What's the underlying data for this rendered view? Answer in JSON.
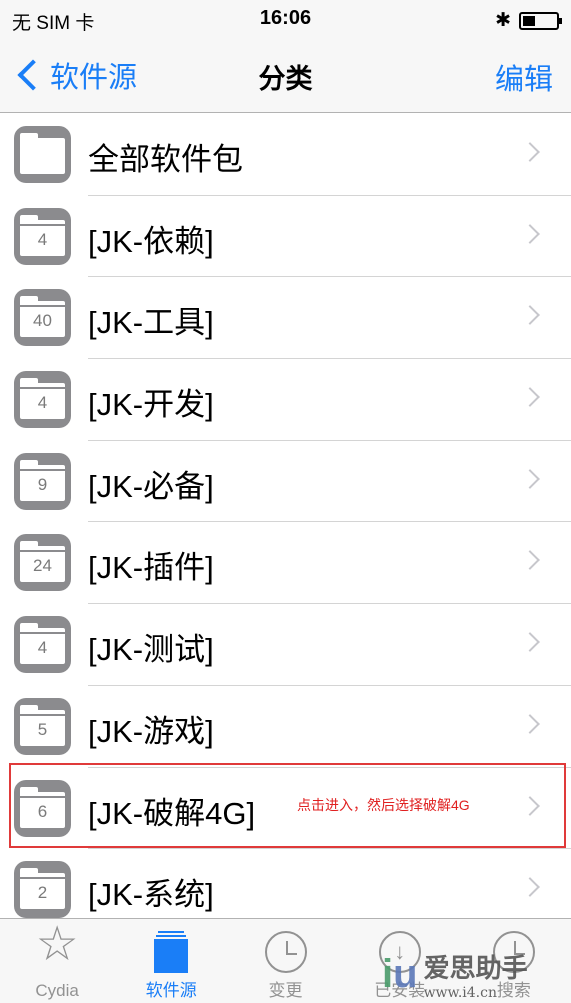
{
  "status": {
    "carrier": "无 SIM 卡",
    "time": "16:06"
  },
  "nav": {
    "back": "软件源",
    "title": "分类",
    "edit": "编辑"
  },
  "rows": [
    {
      "label": "全部软件包",
      "count": ""
    },
    {
      "label": "[JK-依赖]",
      "count": "4"
    },
    {
      "label": "[JK-工具]",
      "count": "40"
    },
    {
      "label": "[JK-开发]",
      "count": "4"
    },
    {
      "label": "[JK-必备]",
      "count": "9"
    },
    {
      "label": "[JK-插件]",
      "count": "24"
    },
    {
      "label": "[JK-测试]",
      "count": "4"
    },
    {
      "label": "[JK-游戏]",
      "count": "5"
    },
    {
      "label": "[JK-破解4G]",
      "count": "6"
    },
    {
      "label": "[JK-系统]",
      "count": "2"
    }
  ],
  "annotation": "点击进入，然后选择破解4G",
  "tabs": [
    {
      "label": "Cydia"
    },
    {
      "label": "软件源"
    },
    {
      "label": "变更"
    },
    {
      "label": "已安装"
    },
    {
      "label": "搜索"
    }
  ],
  "watermark": {
    "brand": "爱思助手",
    "url": "www.i4.cn"
  },
  "colors": {
    "accent": "#1a7ef7",
    "highlight": "#e03a3a"
  }
}
